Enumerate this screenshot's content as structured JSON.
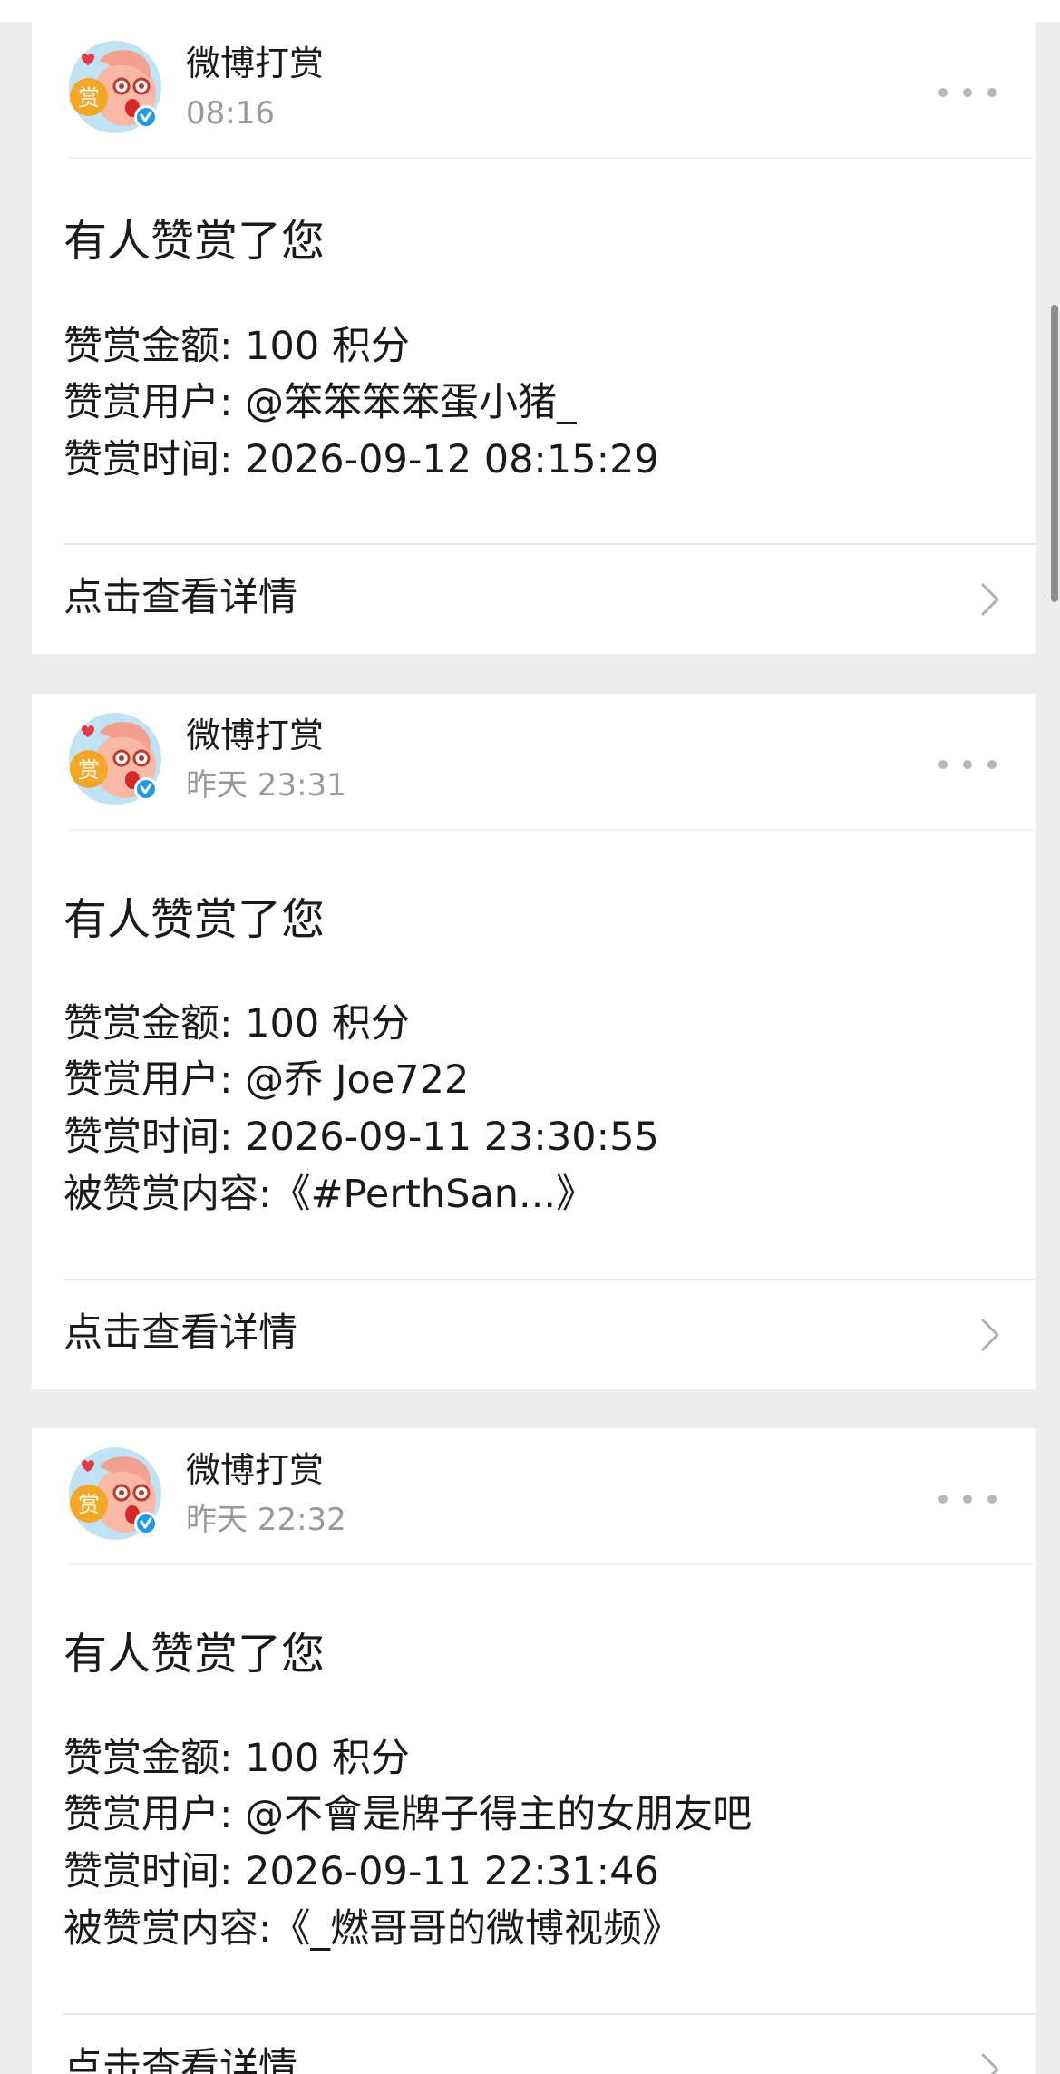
{
  "cards": [
    {
      "sender": "微博打赏",
      "time": "08:16",
      "title": "有人赞赏了您",
      "lines": [
        "赞赏金额: 100 积分",
        "赞赏用户: @笨笨笨笨蛋小猪_",
        "赞赏时间: 2026-09-12 08:15:29"
      ],
      "detail_label": "点击查看详情"
    },
    {
      "sender": "微博打赏",
      "time": "昨天 23:31",
      "title": "有人赞赏了您",
      "lines": [
        "赞赏金额: 100 积分",
        "赞赏用户: @乔 Joe722",
        "赞赏时间: 2026-09-11 23:30:55",
        "被赞赏内容:《#PerthSan...》"
      ],
      "detail_label": "点击查看详情"
    },
    {
      "sender": "微博打赏",
      "time": "昨天 22:32",
      "title": "有人赞赏了您",
      "lines": [
        "赞赏金额: 100 积分",
        "赞赏用户: @不會是牌子得主的女朋友吧",
        "赞赏时间: 2026-09-11 22:31:46",
        "被赞赏内容:《_燃哥哥的微博视频》"
      ],
      "detail_label": "点击查看详情"
    }
  ],
  "avatar_badge_text": "赏",
  "icons": {
    "more": "more-dots-icon",
    "chevron": "chevron-right-icon",
    "verified": "verified-badge-icon"
  },
  "colors": {
    "page_background": "#ededed",
    "card_background": "#ffffff",
    "secondary_text": "#9a9a9a",
    "verified_blue": "#1a9bf0",
    "avatar_badge": "#f5a623"
  }
}
